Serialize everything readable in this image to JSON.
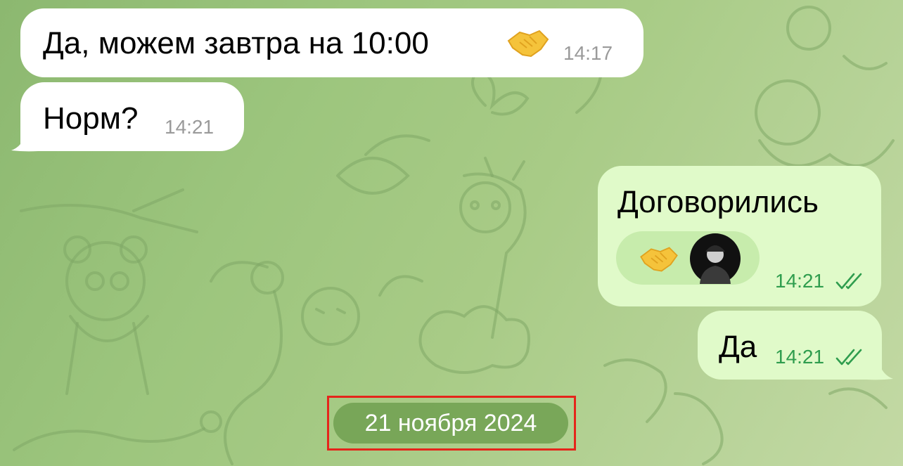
{
  "messages": [
    {
      "id": "m1",
      "direction": "incoming",
      "text": "Да, можем завтра на 10:00",
      "emoji": "handshake",
      "time": "14:17"
    },
    {
      "id": "m2",
      "direction": "incoming",
      "text": "Норм?",
      "time": "14:21"
    },
    {
      "id": "m3",
      "direction": "outgoing",
      "text": "Договорились",
      "time": "14:21",
      "status": "read",
      "reaction": {
        "emoji": "handshake",
        "icon": "handshake-icon",
        "reactor": "avatar"
      }
    },
    {
      "id": "m4",
      "direction": "outgoing",
      "text": "Да",
      "time": "14:21",
      "status": "read"
    }
  ],
  "date_separator": {
    "label": "21 ноября 2024",
    "highlighted": true
  },
  "colors": {
    "incoming_bubble": "#ffffff",
    "outgoing_bubble": "#e0fac9",
    "outgoing_time": "#2f9d4e",
    "incoming_time": "#9a9a9a",
    "date_pill": "#70a050",
    "highlight": "#e5251b"
  }
}
